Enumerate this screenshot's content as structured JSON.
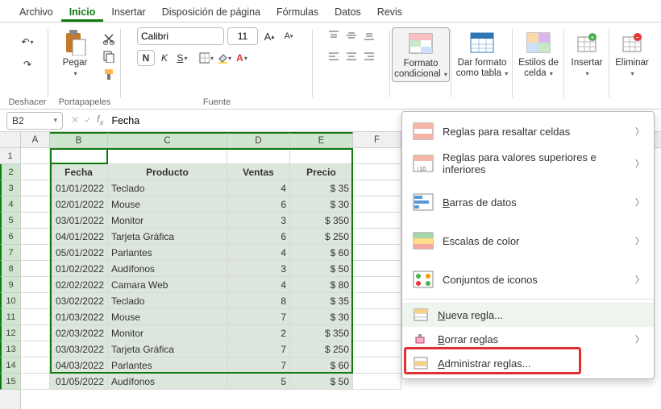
{
  "tabs": [
    "Archivo",
    "Inicio",
    "Insertar",
    "Disposición de página",
    "Fórmulas",
    "Datos",
    "Revis"
  ],
  "active_tab": 1,
  "ribbon": {
    "undo": "Deshacer",
    "clipboard": "Portapapeles",
    "paste": "Pegar",
    "font_group": "Fuente",
    "font_name": "Calibri",
    "font_size": "11",
    "cond_fmt": "Formato condicional",
    "fmt_table": "Dar formato como tabla",
    "cell_styles": "Estilos de celda",
    "insert": "Insertar",
    "delete": "Eliminar"
  },
  "name_box": "B2",
  "formula": "Fecha",
  "columns": [
    "A",
    "B",
    "C",
    "D",
    "E",
    "F"
  ],
  "col_widths": {
    "A": 36,
    "B": 72,
    "C": 148,
    "D": 78,
    "E": 78,
    "F": 60
  },
  "headers": {
    "fecha": "Fecha",
    "producto": "Producto",
    "ventas": "Ventas",
    "precio": "Precio"
  },
  "rows": [
    {
      "fecha": "01/01/2022",
      "producto": "Teclado",
      "ventas": 4,
      "precio": "$ 35"
    },
    {
      "fecha": "02/01/2022",
      "producto": "Mouse",
      "ventas": 6,
      "precio": "$ 30"
    },
    {
      "fecha": "03/01/2022",
      "producto": "Monitor",
      "ventas": 3,
      "precio": "$ 350"
    },
    {
      "fecha": "04/01/2022",
      "producto": "Tarjeta Gráfica",
      "ventas": 6,
      "precio": "$ 250"
    },
    {
      "fecha": "05/01/2022",
      "producto": "Parlantes",
      "ventas": 4,
      "precio": "$ 60"
    },
    {
      "fecha": "01/02/2022",
      "producto": "Audífonos",
      "ventas": 3,
      "precio": "$ 50"
    },
    {
      "fecha": "02/02/2022",
      "producto": "Camara Web",
      "ventas": 4,
      "precio": "$ 80"
    },
    {
      "fecha": "03/02/2022",
      "producto": "Teclado",
      "ventas": 8,
      "precio": "$ 35"
    },
    {
      "fecha": "01/03/2022",
      "producto": "Mouse",
      "ventas": 7,
      "precio": "$ 30"
    },
    {
      "fecha": "02/03/2022",
      "producto": "Monitor",
      "ventas": 2,
      "precio": "$ 350"
    },
    {
      "fecha": "03/03/2022",
      "producto": "Tarjeta Gráfica",
      "ventas": 7,
      "precio": "$ 250"
    },
    {
      "fecha": "04/03/2022",
      "producto": "Parlantes",
      "ventas": 7,
      "precio": "$ 60"
    },
    {
      "fecha": "01/05/2022",
      "producto": "Audífonos",
      "ventas": 5,
      "precio": "$ 50"
    }
  ],
  "menu": {
    "highlight": "Reglas para resaltar celdas",
    "toprules": "Reglas para valores superiores e inferiores",
    "databars": "Barras de datos",
    "colorscales": "Escalas de color",
    "iconsets": "Conjuntos de iconos",
    "newrule": "Nueva regla...",
    "clear": "Borrar reglas",
    "manage": "Administrar reglas..."
  }
}
